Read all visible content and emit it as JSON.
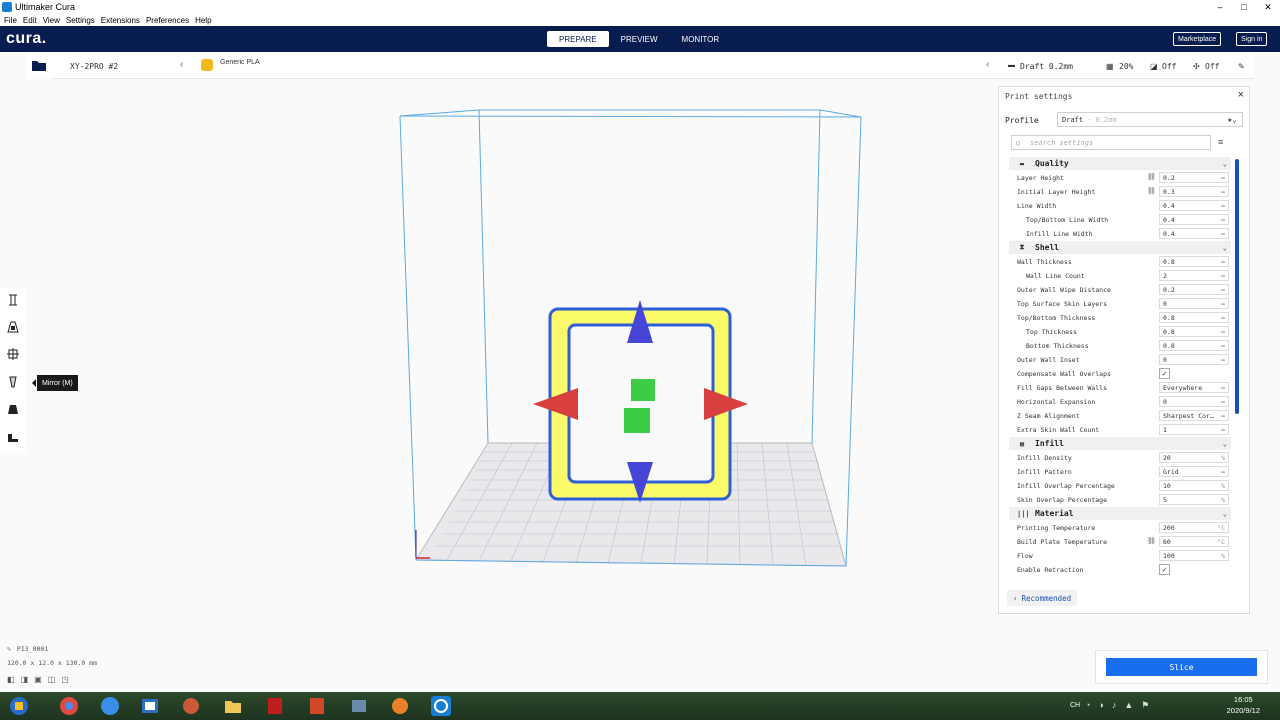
{
  "window": {
    "title": "Ultimaker Cura"
  },
  "menu": [
    "File",
    "Edit",
    "View",
    "Settings",
    "Extensions",
    "Preferences",
    "Help"
  ],
  "header": {
    "logo": "cura.",
    "tabs": [
      "PREPARE",
      "PREVIEW",
      "MONITOR"
    ],
    "active_tab": "PREPARE",
    "marketplace": "Marketplace",
    "signin": "Sign in"
  },
  "printer_bar": {
    "printer": "XY-2PRO #2",
    "material": "Generic PLA",
    "profile": "Draft 0.2mm",
    "infill": "20%",
    "support": "Off",
    "adhesion": "Off"
  },
  "tooltip": "Mirror (M)",
  "print_settings": {
    "title": "Print settings",
    "profile_label": "Profile",
    "profile_value": "Draft",
    "profile_suffix": "- 0.2mm",
    "search_placeholder": "search settings",
    "categories": [
      {
        "name": "Quality",
        "rows": [
          {
            "label": "Layer Height",
            "value": "0.2",
            "link": true
          },
          {
            "label": "Initial Layer Height",
            "value": "0.3",
            "link": true
          },
          {
            "label": "Line Width",
            "value": "0.4"
          },
          {
            "label": "Top/Bottom Line Width",
            "value": "0.4",
            "indent": true
          },
          {
            "label": "Infill Line Width",
            "value": "0.4",
            "indent": true
          }
        ]
      },
      {
        "name": "Shell",
        "rows": [
          {
            "label": "Wall Thickness",
            "value": "0.8"
          },
          {
            "label": "Wall Line Count",
            "value": "2",
            "indent": true
          },
          {
            "label": "Outer Wall Wipe Distance",
            "value": "0.2"
          },
          {
            "label": "Top Surface Skin Layers",
            "value": "0"
          },
          {
            "label": "Top/Bottom Thickness",
            "value": "0.8"
          },
          {
            "label": "Top Thickness",
            "value": "0.8",
            "indent": true
          },
          {
            "label": "Bottom Thickness",
            "value": "0.8",
            "indent": true
          },
          {
            "label": "Outer Wall Inset",
            "value": "0"
          },
          {
            "label": "Compensate Wall Overlaps",
            "value": "✓",
            "check": true
          },
          {
            "label": "Fill Gaps Between Walls",
            "value": "Everywhere"
          },
          {
            "label": "Horizontal Expansion",
            "value": "0"
          },
          {
            "label": "Z Seam Alignment",
            "value": "Sharpest Cor…"
          },
          {
            "label": "Extra Skin Wall Count",
            "value": "1"
          }
        ]
      },
      {
        "name": "Infill",
        "rows": [
          {
            "label": "Infill Density",
            "value": "20",
            "unit": "%"
          },
          {
            "label": "Infill Pattern",
            "value": "Grid"
          },
          {
            "label": "Infill Overlap Percentage",
            "value": "10",
            "unit": "%"
          },
          {
            "label": "Skin Overlap Percentage",
            "value": "5",
            "unit": "%"
          }
        ]
      },
      {
        "name": "Material",
        "rows": [
          {
            "label": "Printing Temperature",
            "value": "200",
            "unit": "°C"
          },
          {
            "label": "Build Plate Temperature",
            "value": "60",
            "unit": "°C",
            "link": true
          },
          {
            "label": "Flow",
            "value": "100",
            "unit": "%"
          },
          {
            "label": "Enable Retraction",
            "value": "✓",
            "check": true
          }
        ]
      }
    ],
    "recommended": "Recommended"
  },
  "object": {
    "name": "PI3_0001",
    "dims": "120.0 x 12.0 x 130.0 mm"
  },
  "slice_label": "Slice",
  "taskbar": {
    "lang": "CH",
    "time": "16:05",
    "date": "2020/9/12"
  }
}
